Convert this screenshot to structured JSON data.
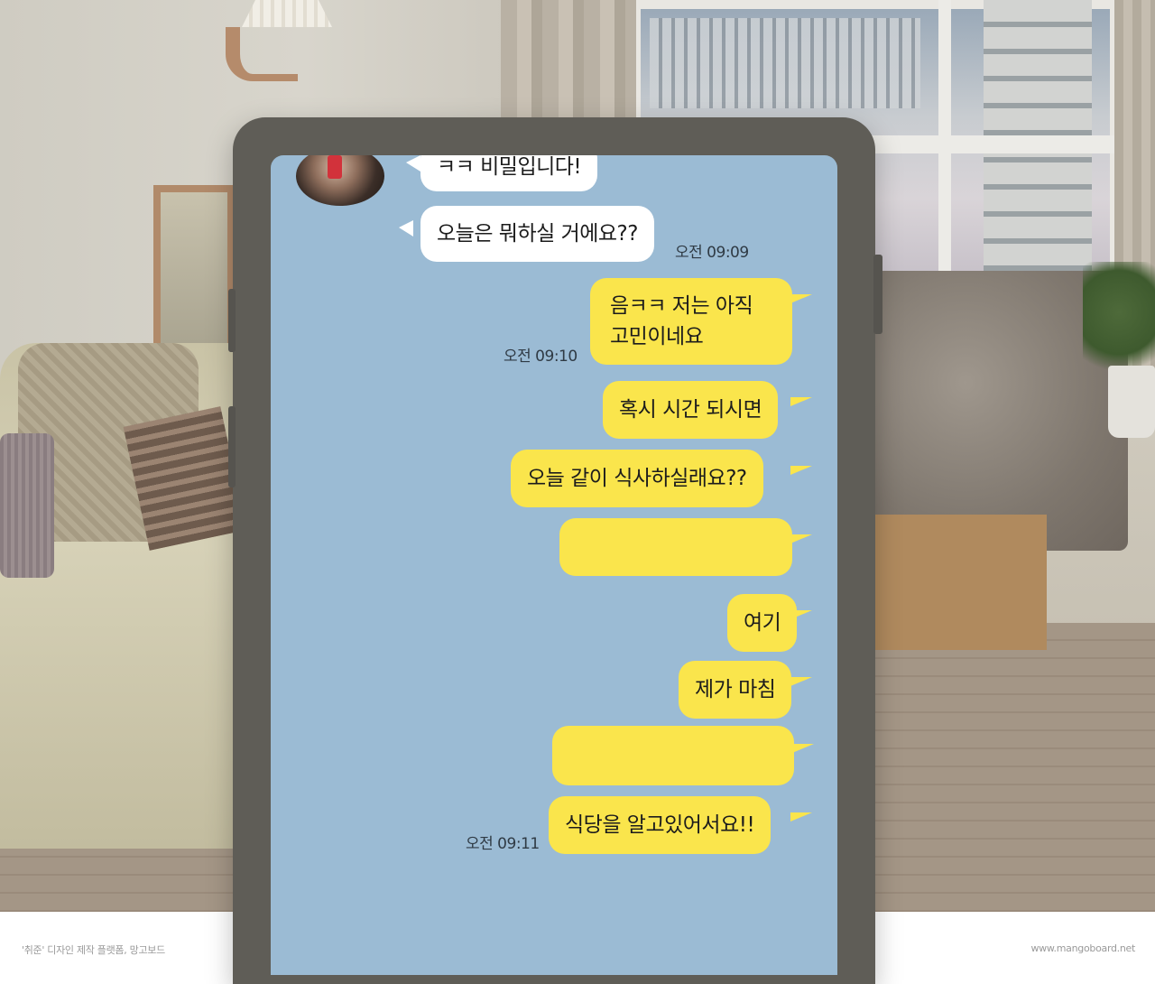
{
  "chat": {
    "messages": [
      {
        "sender": "friend",
        "text": "ㅋㅋ 비밀입니다!"
      },
      {
        "sender": "friend",
        "text": "오늘은 뭐하실 거에요??",
        "time": "오전 09:09"
      },
      {
        "sender": "me",
        "lines": [
          "음ㅋㅋ 저는 아직",
          "고민이네요"
        ],
        "time": "오전 09:10"
      },
      {
        "sender": "me",
        "text": "혹시 시간 되시면"
      },
      {
        "sender": "me",
        "text": "오늘 같이 식사하실래요??"
      },
      {
        "sender": "me",
        "text": ""
      },
      {
        "sender": "me",
        "text": "여기"
      },
      {
        "sender": "me",
        "text": "제가 마침"
      },
      {
        "sender": "me",
        "text": ""
      },
      {
        "sender": "me",
        "text": "식당을 알고있어서요!!",
        "time": "오전 09:11"
      }
    ]
  },
  "footer": {
    "credit": "'취준' 디자인 제작 플랫폼, 망고보드",
    "site": "www.mangoboard.net"
  },
  "colors": {
    "chat_background": "#9bbbd4",
    "my_bubble": "#fae54c",
    "friend_bubble": "#ffffff",
    "phone_frame": "#5f5d57"
  },
  "icons": {
    "avatar": "profile-photo"
  }
}
